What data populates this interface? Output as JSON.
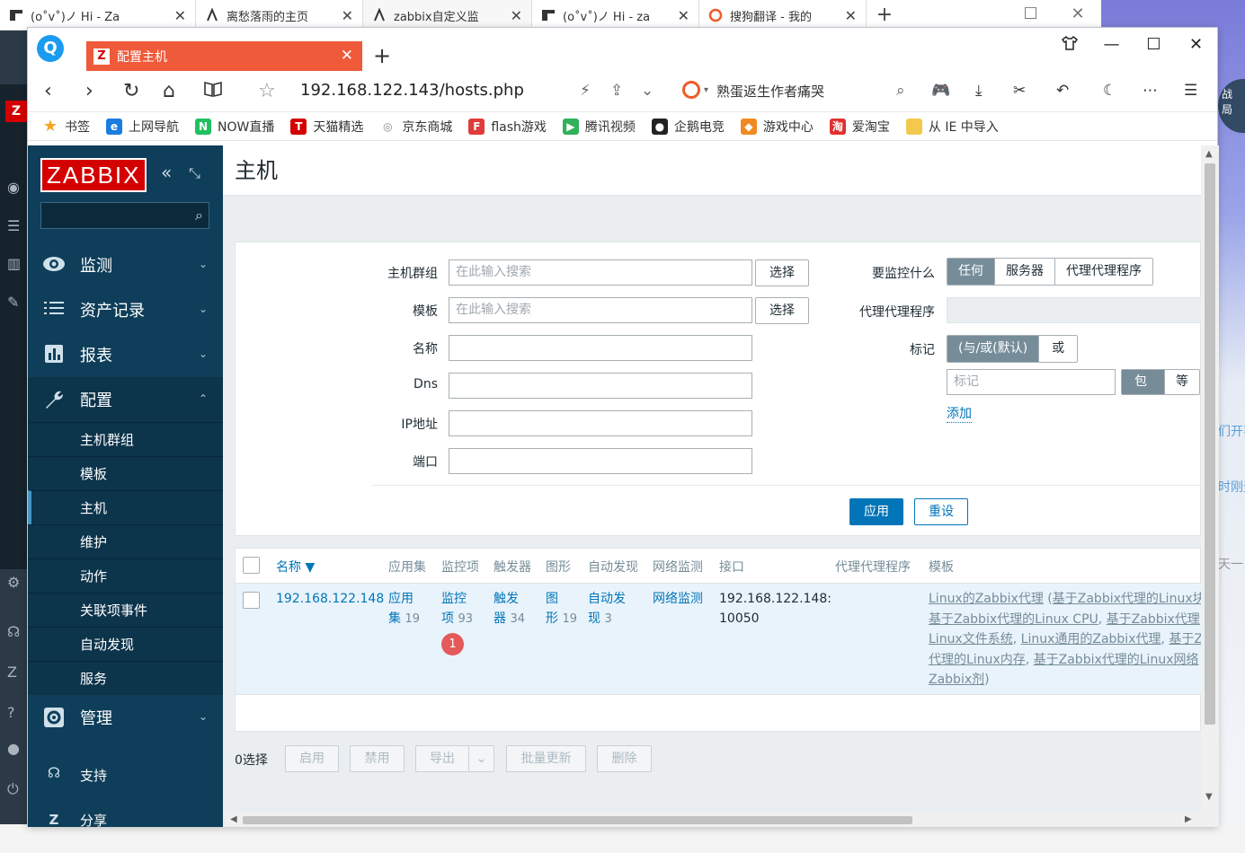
{
  "outer_tabs": [
    {
      "title": "(o˚v˚)ノ Hi - Za",
      "close": "✕"
    },
    {
      "title": "离愁落雨的主页",
      "close": "✕"
    },
    {
      "title": "zabbix自定义监",
      "close": "✕"
    },
    {
      "title": "(o˚v˚)ノ Hi - za",
      "close": "✕"
    },
    {
      "title": "搜狗翻译 - 我的",
      "close": "✕"
    }
  ],
  "outer_add": "+",
  "right_fragments": [
    "战",
    "局",
    "们开花",
    "时刚无",
    "天一"
  ],
  "window": {
    "tab_title": "配置主机",
    "tab_close": "✕",
    "new_tab": "+",
    "url": "192.168.122.143/hosts.php",
    "search_hint": "熟蛋返生作者痛哭"
  },
  "bookmarks": [
    {
      "label": "书签",
      "icon": "star-icon",
      "color": "#f5a623"
    },
    {
      "label": "上网导航",
      "icon": "ie-icon",
      "color": "#1a7de0"
    },
    {
      "label": "NOW直播",
      "icon": "now-icon",
      "color": "#20c060"
    },
    {
      "label": "天猫精选",
      "icon": "tmall-icon",
      "color": "#d40000"
    },
    {
      "label": "京东商城",
      "icon": "globe-icon",
      "color": "#888888"
    },
    {
      "label": "flash游戏",
      "icon": "flash-icon",
      "color": "#e03a3a"
    },
    {
      "label": "腾讯视频",
      "icon": "video-icon",
      "color": "#2fb25a"
    },
    {
      "label": "企鹅电竞",
      "icon": "penguin-icon",
      "color": "#222222"
    },
    {
      "label": "游戏中心",
      "icon": "gamepad-icon",
      "color": "#f08a20"
    },
    {
      "label": "爱淘宝",
      "icon": "taobao-icon",
      "color": "#e03030"
    },
    {
      "label": "从 IE 中导入",
      "icon": "folder-icon",
      "color": "#f2c94c"
    }
  ],
  "zabbix": {
    "logo": "ZABBIX",
    "page_title": "主机",
    "nav": [
      {
        "label": "监测",
        "icon": "eye-icon"
      },
      {
        "label": "资产记录",
        "icon": "list-icon"
      },
      {
        "label": "报表",
        "icon": "chart-icon"
      },
      {
        "label": "配置",
        "icon": "wrench-icon"
      }
    ],
    "config_sub": [
      "主机群组",
      "模板",
      "主机",
      "维护",
      "动作",
      "关联项事件",
      "自动发现",
      "服务"
    ],
    "nav_bottom": [
      {
        "label": "管理",
        "icon": "gear-icon"
      },
      {
        "label": "支持",
        "icon": "headset-icon"
      },
      {
        "label": "分享",
        "icon": "share-icon"
      }
    ]
  },
  "filter": {
    "host_group_label": "主机群组",
    "template_label": "模板",
    "name_label": "名称",
    "dns_label": "Dns",
    "ip_label": "IP地址",
    "port_label": "端口",
    "search_placeholder": "在此输入搜索",
    "select_label": "选择",
    "monitored_by_label": "要监控什么",
    "monitored_by_options": [
      "任何",
      "服务器",
      "代理代理程序"
    ],
    "proxy_label": "代理代理程序",
    "tags_label": "标记",
    "tags_mode_options": [
      "(与/或(默认)",
      "或"
    ],
    "tag_placeholder": "标记",
    "tag_op_options": [
      "包含",
      "等"
    ],
    "add_link": "添加",
    "apply": "应用",
    "reset": "重设"
  },
  "table": {
    "headers": [
      "名称 ▼",
      "应用集",
      "监控项",
      "触发器",
      "图形",
      "自动发现",
      "网络监测",
      "接口",
      "代理代理程序",
      "模板"
    ],
    "row": {
      "name": "192.168.122.148",
      "apps_a": "应用",
      "apps_b": "集",
      "apps_count": "19",
      "items_a": "监控",
      "items_b": "项",
      "items_count": "93",
      "items_problem_badge": "1",
      "triggers_a": "触发",
      "triggers_b": "器",
      "triggers_count": "34",
      "graphs_a": "图",
      "graphs_b": "形",
      "graphs_count": "19",
      "discovery_a": "自动发",
      "discovery_b": "现",
      "discovery_count": "3",
      "web": "网络监测",
      "iface_a": "192.168.122.148:",
      "iface_b": "10050",
      "templates_lines": [
        [
          "Linux的Zabbix代理",
          " (",
          "基于Zabbix代理的Linux块"
        ],
        [
          "基于Zabbix代理的Linux CPU",
          ", ",
          "基于Zabbix代理"
        ],
        [
          "Linux文件系统",
          ", ",
          "Linux通用的Zabbix代理",
          ", ",
          "基于Z"
        ],
        [
          "代理的Linux内存",
          ", ",
          "基于Zabbix代理的Linux网络"
        ],
        [
          "Zabbix剂",
          ")"
        ]
      ]
    }
  },
  "actions": {
    "selected": "0选择",
    "buttons": [
      "启用",
      "禁用",
      "导出",
      "批量更新",
      "删除"
    ]
  }
}
